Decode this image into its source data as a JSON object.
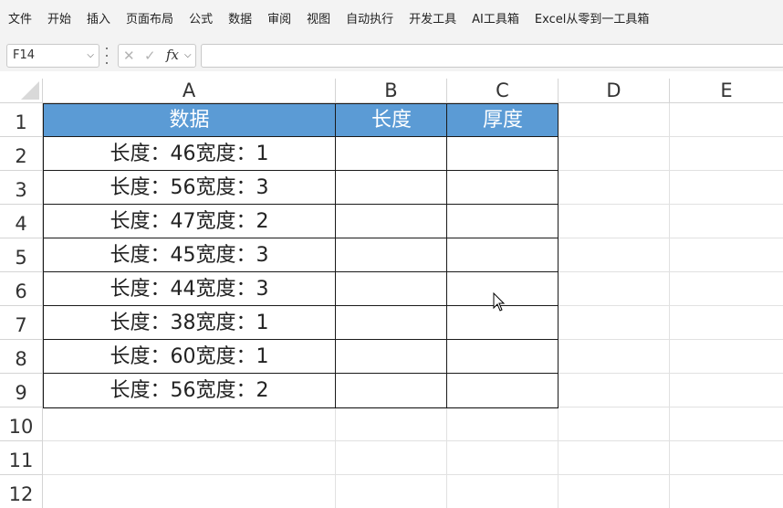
{
  "menu": [
    "文件",
    "开始",
    "插入",
    "页面布局",
    "公式",
    "数据",
    "审阅",
    "视图",
    "自动执行",
    "开发工具",
    "AI工具箱",
    "Excel从零到一工具箱"
  ],
  "formula_bar": {
    "name_box": "F14",
    "fx_label": "fx",
    "formula_value": ""
  },
  "columns": [
    "A",
    "B",
    "C",
    "D",
    "E"
  ],
  "rows": [
    "1",
    "2",
    "3",
    "4",
    "5",
    "6",
    "7",
    "8",
    "9",
    "10",
    "11",
    "12"
  ],
  "table": {
    "headers": [
      "数据",
      "长度",
      "厚度"
    ],
    "rows": [
      [
        "长度：46宽度：1",
        "",
        ""
      ],
      [
        "长度：56宽度：3",
        "",
        ""
      ],
      [
        "长度：47宽度：2",
        "",
        ""
      ],
      [
        "长度：45宽度：3",
        "",
        ""
      ],
      [
        "长度：44宽度：3",
        "",
        ""
      ],
      [
        "长度：38宽度：1",
        "",
        ""
      ],
      [
        "长度：60宽度：1",
        "",
        ""
      ],
      [
        "长度：56宽度：2",
        "",
        ""
      ]
    ]
  },
  "colors": {
    "header_fill": "#5b9bd5",
    "header_text": "#ffffff",
    "table_border": "#1a1a1a"
  }
}
